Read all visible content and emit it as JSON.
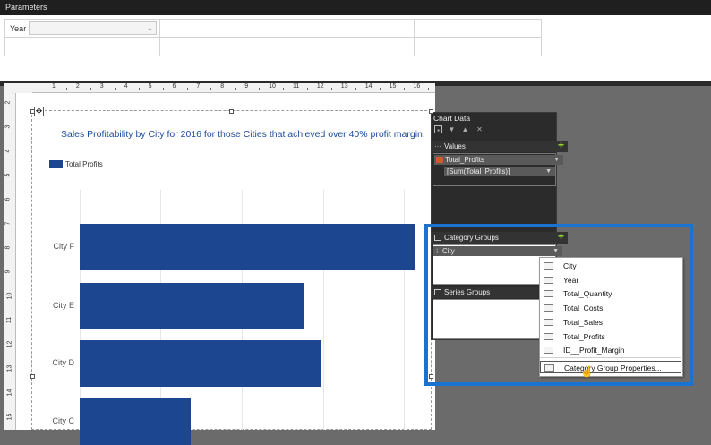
{
  "parameters": {
    "header": "Parameters",
    "year_label": "Year",
    "year_value": ""
  },
  "ruler": {
    "top_numbers": [
      "1",
      "2",
      "3",
      "4",
      "5",
      "6",
      "7",
      "8",
      "9",
      "10",
      "11",
      "12",
      "13",
      "14",
      "15",
      "16"
    ],
    "left_numbers": [
      "2",
      "3",
      "4",
      "5",
      "6",
      "7",
      "8",
      "9",
      "10",
      "11",
      "12",
      "13",
      "14",
      "15"
    ]
  },
  "chart": {
    "title": "Sales Profitability by City for 2016 for those Cities that achieved over 40% profit margin.",
    "legend_label": "Total Profits",
    "bar_color": "#1c4690"
  },
  "chart_data": {
    "type": "bar",
    "orientation": "horizontal",
    "title": "Sales Profitability by City for 2016 for those Cities that achieved over 40% profit margin.",
    "categories": [
      "City F",
      "City E",
      "City D",
      "City C"
    ],
    "series": [
      {
        "name": "Total Profits",
        "values": [
          1.0,
          0.67,
          0.72,
          0.33
        ]
      }
    ],
    "legend": "top-left",
    "grid": true
  },
  "chart_data_pane": {
    "title": "Chart Data",
    "values_label": "Values",
    "value_field": "Total_Profits",
    "value_expression": "[Sum(Total_Profits)]",
    "category_groups_label": "Category Groups",
    "category_field": "City",
    "series_groups_label": "Series Groups"
  },
  "menu": {
    "items": [
      "City",
      "Year",
      "Total_Quantity",
      "Total_Costs",
      "Total_Sales",
      "Total_Profits",
      "ID__Profit_Margin"
    ],
    "properties": "Category Group Properties..."
  },
  "colors": {
    "highlight": "#1a73d1",
    "add_icon": "#9be22d"
  }
}
